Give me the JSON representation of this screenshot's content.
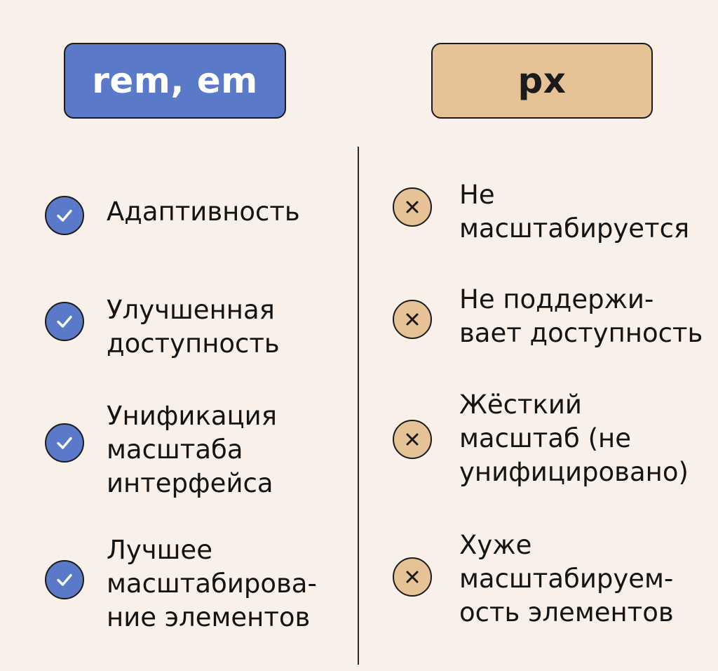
{
  "columns": {
    "left": {
      "header": "rem, em",
      "items": [
        {
          "lines": [
            "Адаптивность"
          ],
          "icon": "check-icon"
        },
        {
          "lines": [
            "Улучшенная",
            "доступность"
          ],
          "icon": "check-icon"
        },
        {
          "lines": [
            "Унификация",
            "масштаба",
            "интерфейса"
          ],
          "icon": "check-icon"
        },
        {
          "lines": [
            "Лучшее",
            "масштабирова-",
            "ние элементов"
          ],
          "icon": "check-icon"
        }
      ]
    },
    "right": {
      "header": "px",
      "items": [
        {
          "lines": [
            "Не",
            "масштабируется"
          ],
          "icon": "cross-icon"
        },
        {
          "lines": [
            "Не поддержи-",
            "вает доступность"
          ],
          "icon": "cross-icon"
        },
        {
          "lines": [
            "Жёсткий",
            "масштаб (не",
            "унифицировано)"
          ],
          "icon": "cross-icon"
        },
        {
          "lines": [
            "Хуже",
            "масштабируем-",
            "ость элементов"
          ],
          "icon": "cross-icon"
        }
      ]
    }
  },
  "colors": {
    "background": "#f8f0e9",
    "rem_accent": "#5a79c8",
    "px_accent": "#e6c397",
    "outline": "#1b1b1b"
  }
}
